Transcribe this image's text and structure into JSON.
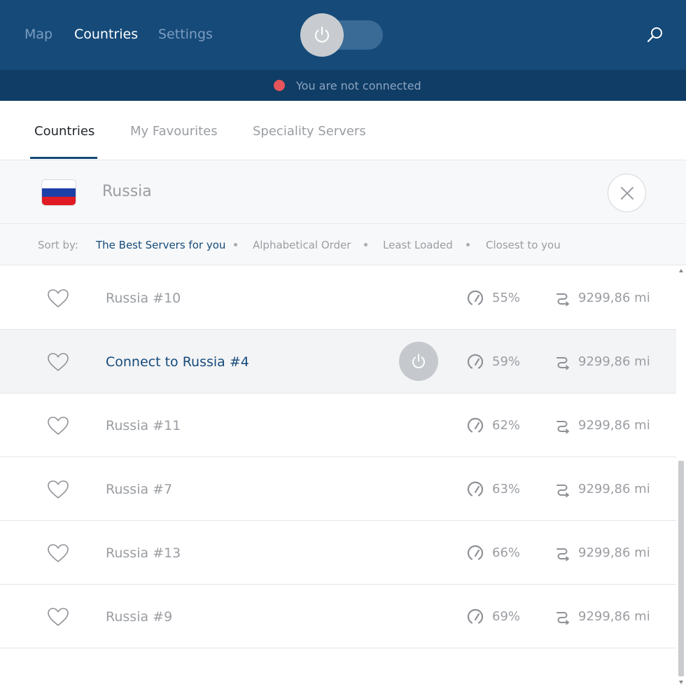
{
  "nav": {
    "links": [
      {
        "label": "Map"
      },
      {
        "label": "Countries"
      },
      {
        "label": "Settings"
      }
    ]
  },
  "status": {
    "text": "You are not connected",
    "color": "#e5555a"
  },
  "tabs": [
    {
      "label": "Countries"
    },
    {
      "label": "My Favourites"
    },
    {
      "label": "Speciality Servers"
    }
  ],
  "country": {
    "name": "Russia",
    "flag_colors": [
      "#ffffff",
      "#1c3fa8",
      "#e01b24"
    ]
  },
  "sort": {
    "label": "Sort by:",
    "options": [
      {
        "label": "The Best Servers for you"
      },
      {
        "label": "Alphabetical Order"
      },
      {
        "label": "Least Loaded"
      },
      {
        "label": "Closest to you"
      }
    ]
  },
  "servers": [
    {
      "name": "Russia #10",
      "load": "55%",
      "distance": "9299,86 mi"
    },
    {
      "name": "Connect to Russia #4",
      "load": "59%",
      "distance": "9299,86 mi"
    },
    {
      "name": "Russia #11",
      "load": "62%",
      "distance": "9299,86 mi"
    },
    {
      "name": "Russia #7",
      "load": "63%",
      "distance": "9299,86 mi"
    },
    {
      "name": "Russia #13",
      "load": "66%",
      "distance": "9299,86 mi"
    },
    {
      "name": "Russia #9",
      "load": "69%",
      "distance": "9299,86 mi"
    }
  ],
  "colors": {
    "header": "#154a79",
    "status_bar": "#0f3d66",
    "accent": "#154a79"
  },
  "icons": {
    "power": "power-icon",
    "search": "search-icon",
    "close": "close-icon",
    "favourite": "heart-icon",
    "load": "gauge-icon",
    "distance": "distance-icon"
  }
}
